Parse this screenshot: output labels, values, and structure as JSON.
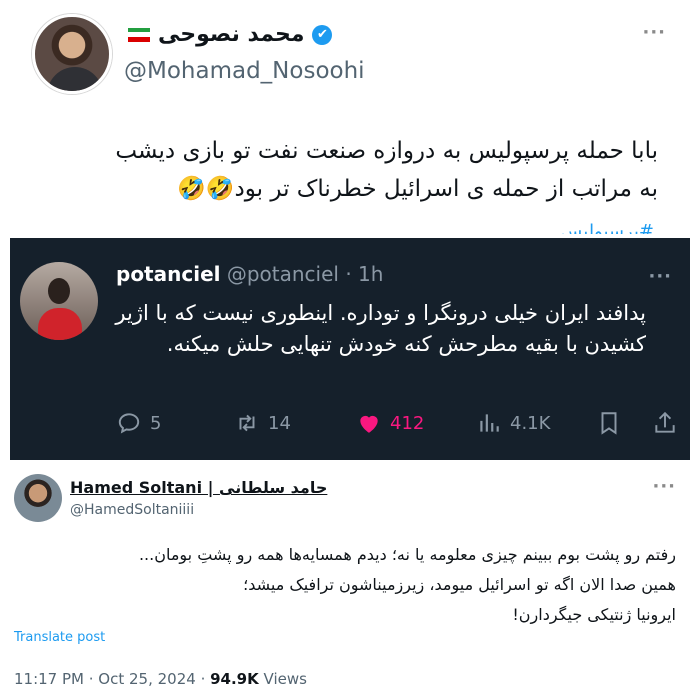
{
  "top_tweet": {
    "name": "محمد نصوحی",
    "verified_glyph": "✔",
    "flag": "iran-flag",
    "handle": "@Mohamad_Nosoohi",
    "more": "···",
    "text_line1": "بابا حمله پرسپولیس به دروازه صنعت نفت تو بازی دیشب",
    "text_line2": "به مراتب از حمله ی اسرائیل خطرناک تر بود🤣🤣",
    "hashtag_partial": "#پرسپولیس"
  },
  "quoted_tweet": {
    "username": "potanciel",
    "handle": "@potanciel",
    "time": "· 1h",
    "more": "···",
    "text": "پدافند ایران خیلی درونگرا و توداره. اینطوری نیست که با اژیر کشیدن با بقیه مطرحش کنه خودش تنهایی حلش میکنه.",
    "actions": {
      "replies": "5",
      "retweets": "14",
      "likes": "412",
      "views": "4.1K"
    },
    "colors": {
      "background": "#15202b",
      "like": "#f91880"
    }
  },
  "bottom_tweet": {
    "name": "Hamed Soltani | حامد سلطانی",
    "handle": "@HamedSoltaniiii",
    "more": "···",
    "text_line1": "رفتم رو پشت بوم ببینم چیزی معلومه یا نه؛ دیدم همسایه‌ها همه رو پشتِ بومان...",
    "text_line2": "همین صدا الان اگه تو اسرائیل میومد، زیرزمیناشون ترافیک میشد؛",
    "text_line3": "ایرونیا ژنتیکی جیگردارن!",
    "translate_label": "Translate post",
    "time": "11:17 PM",
    "date": "Oct 25, 2024",
    "views_count": "94.9K",
    "views_label": "Views"
  }
}
